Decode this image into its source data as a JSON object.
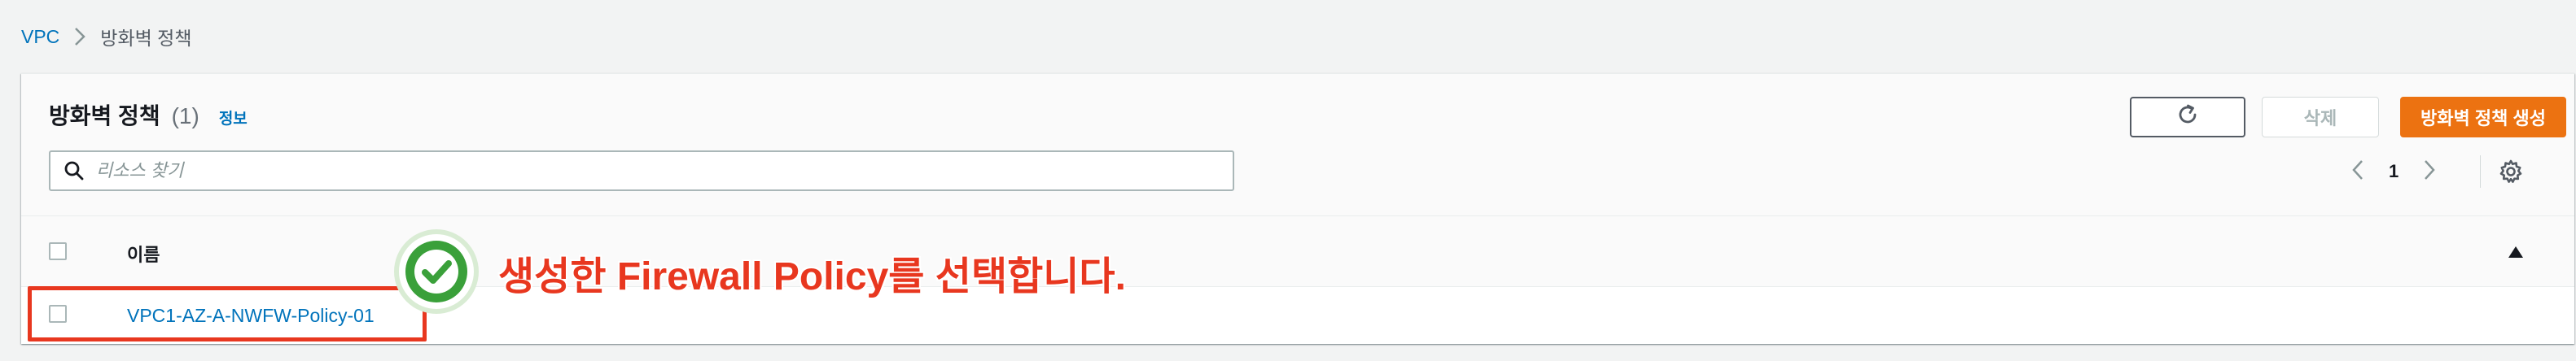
{
  "breadcrumb": {
    "root": "VPC",
    "current": "방화벽 정책"
  },
  "header": {
    "title": "방화벽 정책",
    "count": "(1)",
    "info": "정보"
  },
  "toolbar": {
    "refresh_icon": "refresh-icon",
    "delete_label": "삭제",
    "create_label": "방화벽 정책 생성"
  },
  "search": {
    "placeholder": "리소스 찾기"
  },
  "pagination": {
    "current_page": "1"
  },
  "table": {
    "columns": [
      "이름"
    ],
    "rows": [
      {
        "name": "VPC1-AZ-A-NWFW-Policy-01"
      }
    ]
  },
  "annotation": {
    "text": "생성한 Firewall Policy를 선택합니다."
  },
  "colors": {
    "accent_orange": "#ec7211",
    "link_blue": "#0073bb",
    "annotation_red": "#e8371f",
    "check_green": "#3aa03a"
  }
}
